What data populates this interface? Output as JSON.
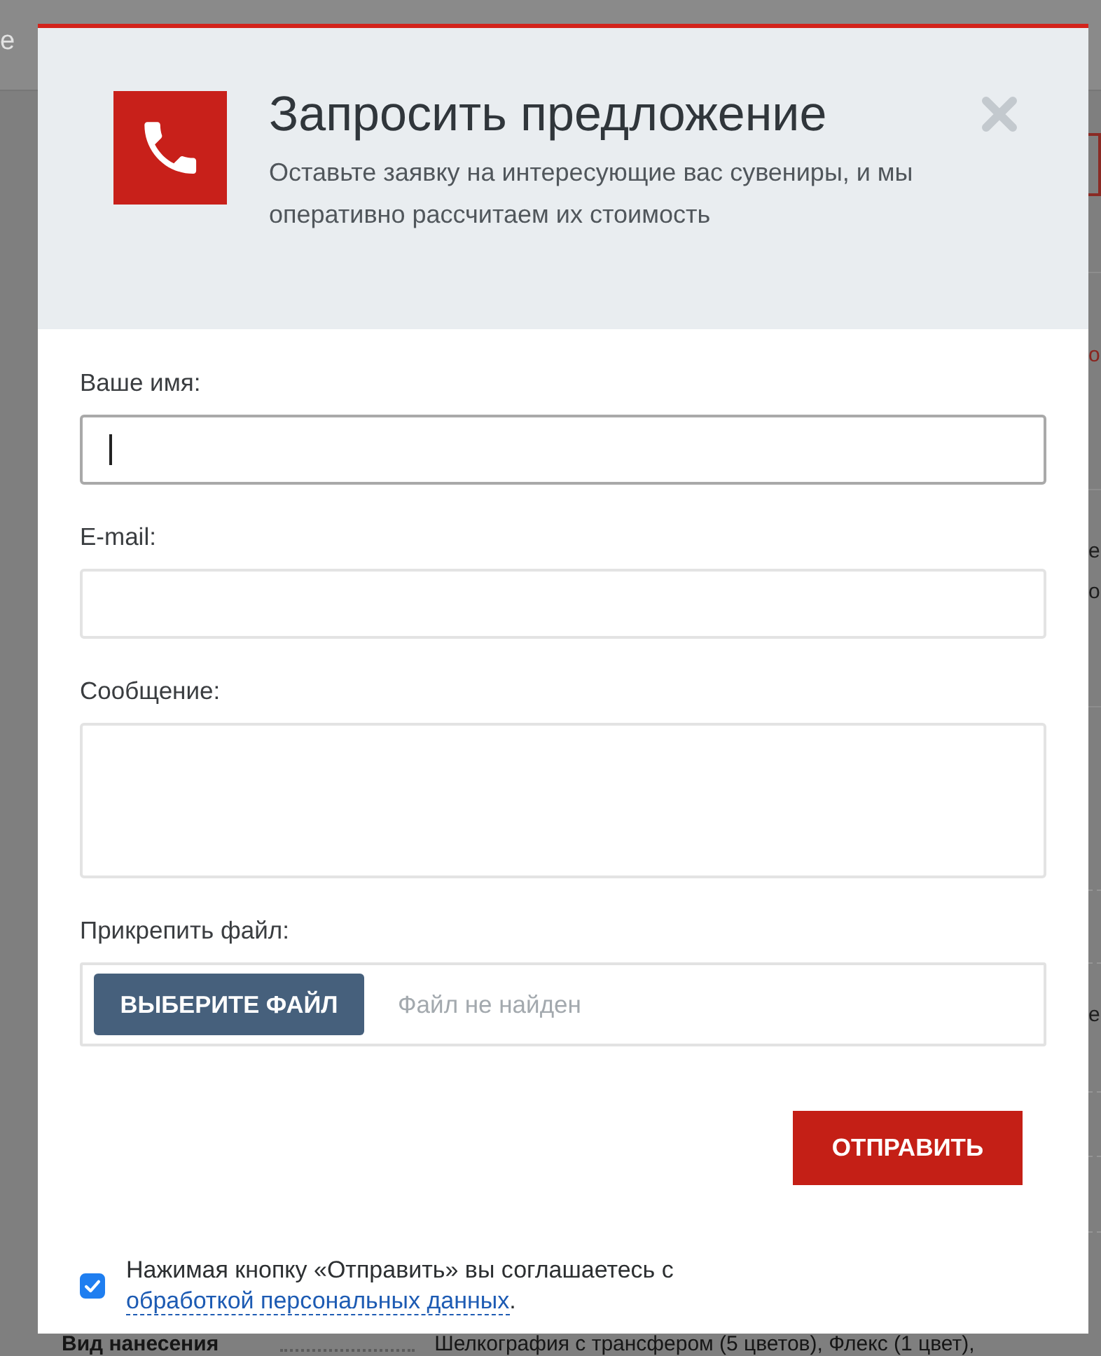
{
  "page": {
    "header_fragment": "е",
    "side_fragments": [
      {
        "text": "о",
        "kind": "link"
      },
      {
        "text": "е",
        "kind": "text"
      },
      {
        "text": "о",
        "kind": "text"
      },
      {
        "text": "е",
        "kind": "text"
      }
    ],
    "spec_row": {
      "label": "Вид нанесения",
      "value": "Шелкография с трансфером (5 цветов), Флекс (1 цвет),"
    }
  },
  "modal": {
    "title": "Запросить предложение",
    "subtitle": "Оставьте заявку на интересующие вас сувениры, и мы оперативно рассчитаем их стоимость",
    "fields": [
      {
        "label": "Ваше имя:",
        "kind": "input",
        "focused": true
      },
      {
        "label": "E-mail:",
        "kind": "input",
        "focused": false
      },
      {
        "label": "Сообщение:",
        "kind": "textarea",
        "focused": false
      },
      {
        "label": "Прикрепить файл:",
        "kind": "file",
        "button": "ВЫБЕРИТЕ ФАЙЛ",
        "status": "Файл не найден"
      }
    ],
    "submit": "ОТПРАВИТЬ",
    "consent": {
      "checked": true,
      "text": "Нажимая кнопку «Отправить» вы соглашаетесь с",
      "link": "обработкой персональных данных",
      "end": "."
    }
  }
}
